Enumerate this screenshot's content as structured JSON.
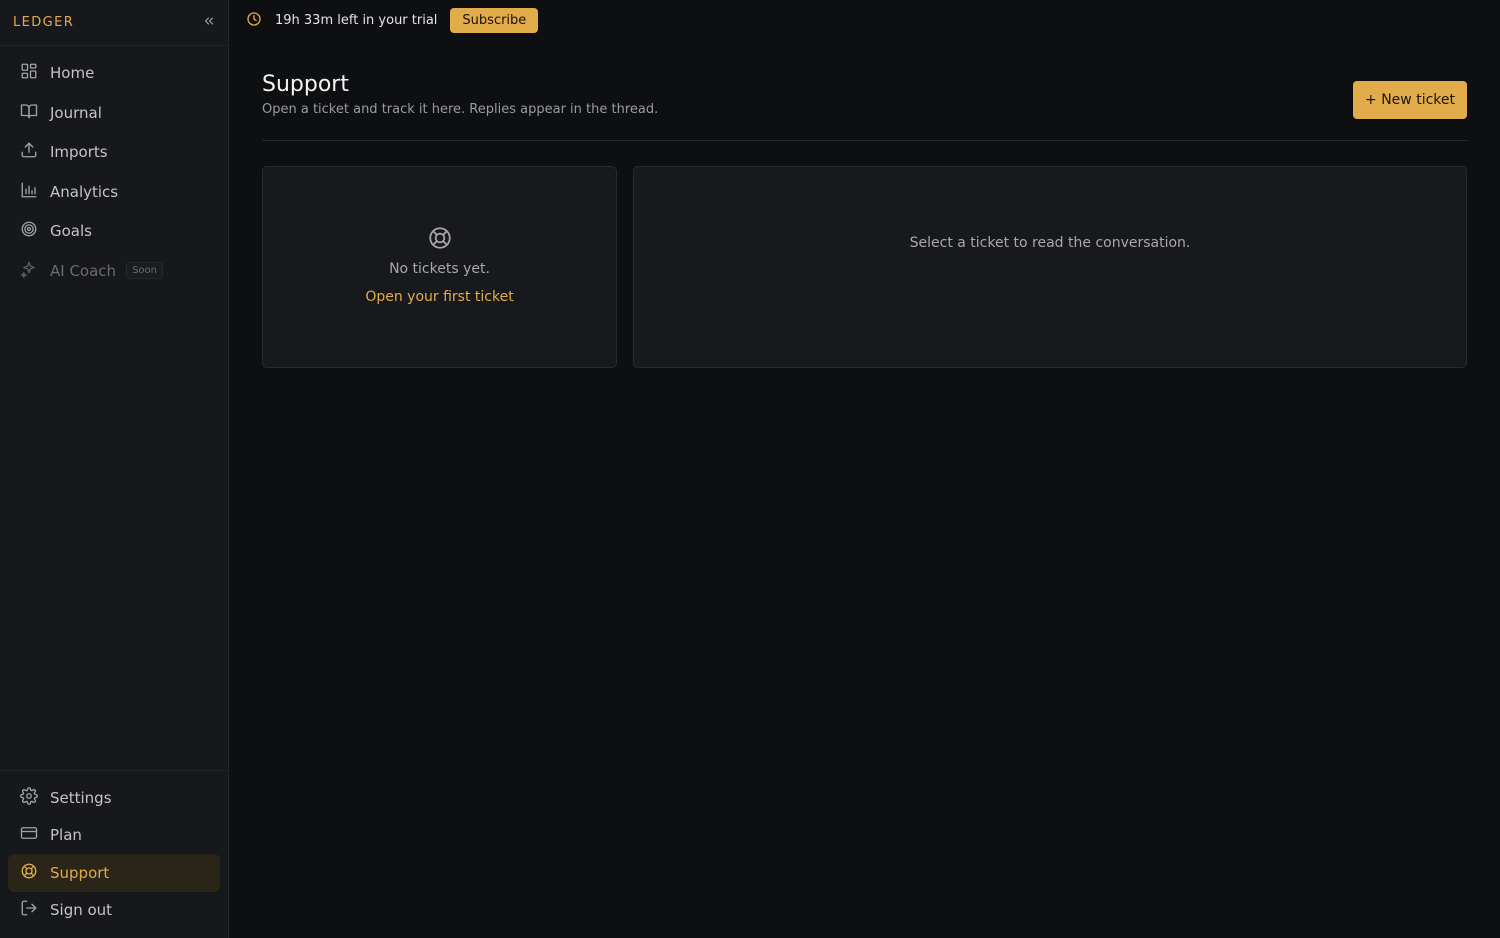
{
  "app": {
    "brand": "LEDGER",
    "accent": "#e3ac4a",
    "collapse_icon": "chevrons-left-icon"
  },
  "sidebar": {
    "items": [
      {
        "label": "Home",
        "icon": "grid-icon"
      },
      {
        "label": "Journal",
        "icon": "book-icon"
      },
      {
        "label": "Imports",
        "icon": "upload-icon"
      },
      {
        "label": "Analytics",
        "icon": "bar-chart-icon"
      },
      {
        "label": "Goals",
        "icon": "target-icon"
      },
      {
        "label": "AI Coach",
        "icon": "sparkle-icon",
        "badge": "Soon"
      }
    ],
    "bottom_items": [
      {
        "label": "Settings",
        "icon": "gear-icon"
      },
      {
        "label": "Plan",
        "icon": "credit-card-icon"
      },
      {
        "label": "Support",
        "icon": "lifebuoy-icon",
        "active": true
      },
      {
        "label": "Sign out",
        "icon": "logout-icon"
      }
    ]
  },
  "trial": {
    "icon": "clock-icon",
    "text": "19h 33m left in your trial",
    "subscribe_label": "Subscribe"
  },
  "page": {
    "title": "Support",
    "subtitle": "Open a ticket and track it here. Replies appear in the thread.",
    "new_ticket_label": "+ New ticket"
  },
  "tickets": {
    "empty_icon": "lifebuoy-icon",
    "empty_text": "No tickets yet.",
    "empty_link": "Open your first ticket"
  },
  "thread": {
    "placeholder": "Select a ticket to read the conversation."
  }
}
